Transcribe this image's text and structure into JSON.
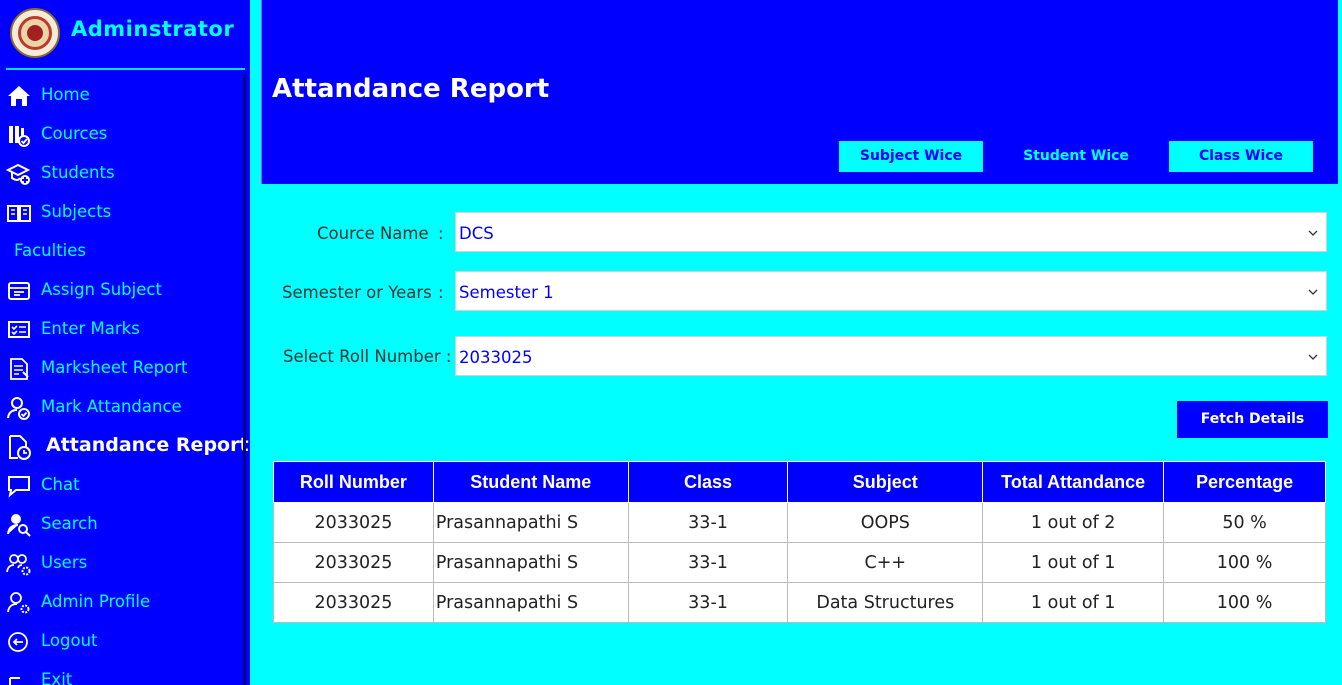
{
  "sidebar": {
    "title": "Adminstrator",
    "items": [
      {
        "label": "Home",
        "icon": "home-icon"
      },
      {
        "label": "Cources",
        "icon": "courses-icon"
      },
      {
        "label": "Students",
        "icon": "students-icon"
      },
      {
        "label": "Subjects",
        "icon": "book-icon"
      },
      {
        "label": "Faculties",
        "icon": ""
      },
      {
        "label": "Assign Subject",
        "icon": "assign-icon"
      },
      {
        "label": "Enter Marks",
        "icon": "marks-icon"
      },
      {
        "label": "Marksheet Report",
        "icon": "report-icon"
      },
      {
        "label": "Mark Attandance",
        "icon": "user-check-icon"
      },
      {
        "label": "Attandance Report",
        "icon": "document-clock-icon",
        "active": true
      },
      {
        "label": "Chat",
        "icon": "chat-icon"
      },
      {
        "label": "Search",
        "icon": "user-search-icon"
      },
      {
        "label": "Users",
        "icon": "users-gear-icon"
      },
      {
        "label": "Admin Profile",
        "icon": "user-gear-icon"
      },
      {
        "label": "Logout",
        "icon": "logout-icon"
      },
      {
        "label": "Exit",
        "icon": "exit-icon"
      }
    ]
  },
  "header": {
    "title": "Attandance Report",
    "tabs": [
      {
        "label": "Subject Wice"
      },
      {
        "label": "Student Wice"
      },
      {
        "label": "Class Wice"
      }
    ]
  },
  "form": {
    "course_label": "Cource Name",
    "course_sep": ":",
    "course_value": "DCS",
    "semester_label": "Semester or Years",
    "semester_sep": ":",
    "semester_value": "Semester 1",
    "roll_label": "Select Roll Number :",
    "roll_value": "2033025",
    "fetch_label": "Fetch Details"
  },
  "table": {
    "headers": [
      "Roll Number",
      "Student Name",
      "Class",
      "Subject",
      "Total Attandance",
      "Percentage"
    ],
    "rows": [
      [
        "2033025",
        "Prasannapathi S",
        "33-1",
        "OOPS",
        "1 out of 2",
        "50 %"
      ],
      [
        "2033025",
        "Prasannapathi S",
        "33-1",
        "C++",
        "1 out of 1",
        "100 %"
      ],
      [
        "2033025",
        "Prasannapathi S",
        "33-1",
        "Data Structures",
        "1 out of 1",
        "100 %"
      ]
    ]
  },
  "colors": {
    "primary": "#0000ff",
    "accent": "#00ffff",
    "white": "#ffffff"
  }
}
